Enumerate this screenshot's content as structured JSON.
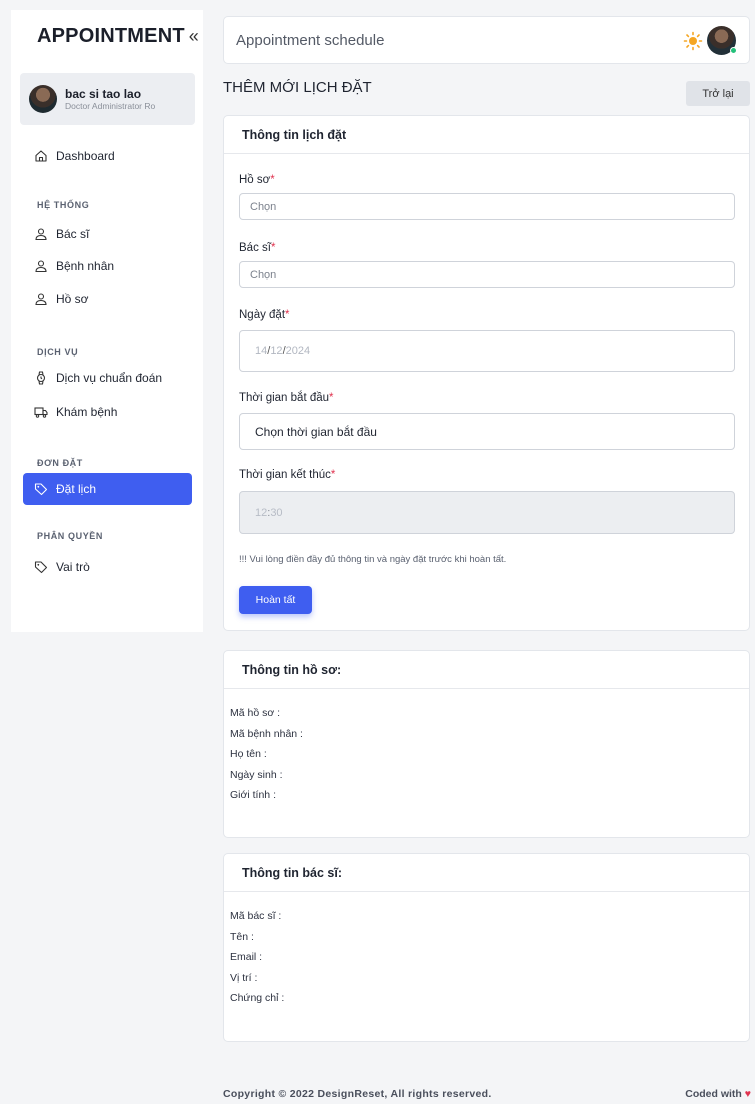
{
  "sidebar": {
    "brand": "APPOINTMENT",
    "collapse_glyph": "«",
    "user": {
      "name": "bac si tao lao",
      "role": "Doctor Administrator Ro"
    },
    "dashboard": {
      "label": "Dashboard",
      "icon": "home-icon"
    },
    "sections": {
      "system": "HỆ THỐNG",
      "services": "DỊCH VỤ",
      "orders": "ĐƠN ĐẶT",
      "permissions": "PHÂN QUYỀN"
    },
    "items": {
      "doctor": {
        "label": "Bác sĩ",
        "icon": "user-icon"
      },
      "patient": {
        "label": "Bệnh nhân",
        "icon": "user-icon"
      },
      "record": {
        "label": "Hồ sơ",
        "icon": "user-icon"
      },
      "diagnosis": {
        "label": "Dịch vụ chuẩn đoán",
        "icon": "watch-icon"
      },
      "checkup": {
        "label": "Khám bệnh",
        "icon": "truck-icon"
      },
      "booking": {
        "label": "Đặt lịch",
        "icon": "tag-icon",
        "active": true
      },
      "roles": {
        "label": "Vai trò",
        "icon": "tag-icon"
      }
    }
  },
  "header": {
    "title": "Appointment schedule",
    "theme_icon": "sun-icon",
    "accent": "#3f5ef0"
  },
  "page": {
    "heading": "THÊM MỚI LỊCH ĐẶT",
    "back_label": "Trở lại"
  },
  "form": {
    "card_title": "Thông tin lịch đặt",
    "record_label": "Hồ sơ",
    "record_placeholder": "Chọn",
    "doctor_label": "Bác sĩ",
    "doctor_placeholder": "Chọn",
    "date_label": "Ngày đặt",
    "date_day": "14",
    "date_month": "12",
    "date_year": "2024",
    "date_sep": "/",
    "start_label": "Thời gian bắt đầu",
    "start_value": "Chọn thời gian bắt đầu",
    "end_label": "Thời gian kết thúc",
    "end_hour": "12",
    "end_sep": ":",
    "end_minute": "30",
    "required_mark": "*",
    "notice": "!!! Vui lòng điền đầy đủ thông tin và ngày đặt trước khi hoàn tất.",
    "submit_label": "Hoàn tất"
  },
  "record_info": {
    "title": "Thông tin hồ sơ:",
    "rows": [
      "Mã hồ sơ :",
      "Mã bệnh nhân :",
      "Họ tên :",
      "Ngày sinh :",
      "Giới tính :"
    ]
  },
  "doctor_info": {
    "title": "Thông tin bác sĩ:",
    "rows": [
      "Mã bác sĩ :",
      "Tên :",
      "Email :",
      "Vị trí :",
      "Chứng chỉ :"
    ]
  },
  "footer": {
    "copyright": "Copyright © 2022 DesignReset, All rights reserved.",
    "coded_with": "Coded with",
    "heart_glyph": "♥"
  }
}
